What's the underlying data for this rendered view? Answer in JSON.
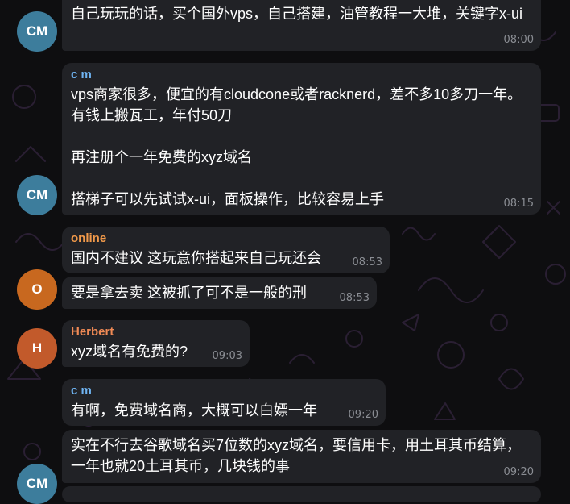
{
  "colors": {
    "background": "#0e0e10",
    "bubble": "#212226",
    "time": "#8a8d93",
    "avatar_cm": "#3d7d9c",
    "avatar_o": "#c8681f",
    "avatar_h": "#c25a2b",
    "name_cm": "#6fb4f2",
    "name_online": "#f29a4a",
    "name_herbert": "#f08a55"
  },
  "avatars": {
    "cm": "CM",
    "o": "O",
    "h": "H"
  },
  "messages": [
    {
      "sender": "",
      "text": "自己玩玩的话，买个国外vps，自己搭建，油管教程一大堆，关键字x-ui",
      "time": "08:00"
    },
    {
      "sender": "c m",
      "text": "vps商家很多，便宜的有cloudcone或者racknerd，差不多10多刀一年。有钱上搬瓦工，年付50刀\n\n再注册个一年免费的xyz域名\n\n搭梯子可以先试试x-ui，面板操作，比较容易上手",
      "time": "08:15"
    },
    {
      "sender": "online",
      "text": "国内不建议 这玩意你搭起来自己玩还会",
      "time": "08:53"
    },
    {
      "sender": "",
      "text": "要是拿去卖 这被抓了可不是一般的刑",
      "time": "08:53"
    },
    {
      "sender": "Herbert",
      "text": "xyz域名有免费的?",
      "time": "09:03"
    },
    {
      "sender": "c m",
      "text": "有啊，免费域名商，大概可以白嫖一年",
      "time": "09:20"
    },
    {
      "sender": "",
      "text": "实在不行去谷歌域名买7位数的xyz域名，要信用卡，用土耳其币结算，一年也就20土耳其币，几块钱的事",
      "time": "09:20"
    }
  ]
}
